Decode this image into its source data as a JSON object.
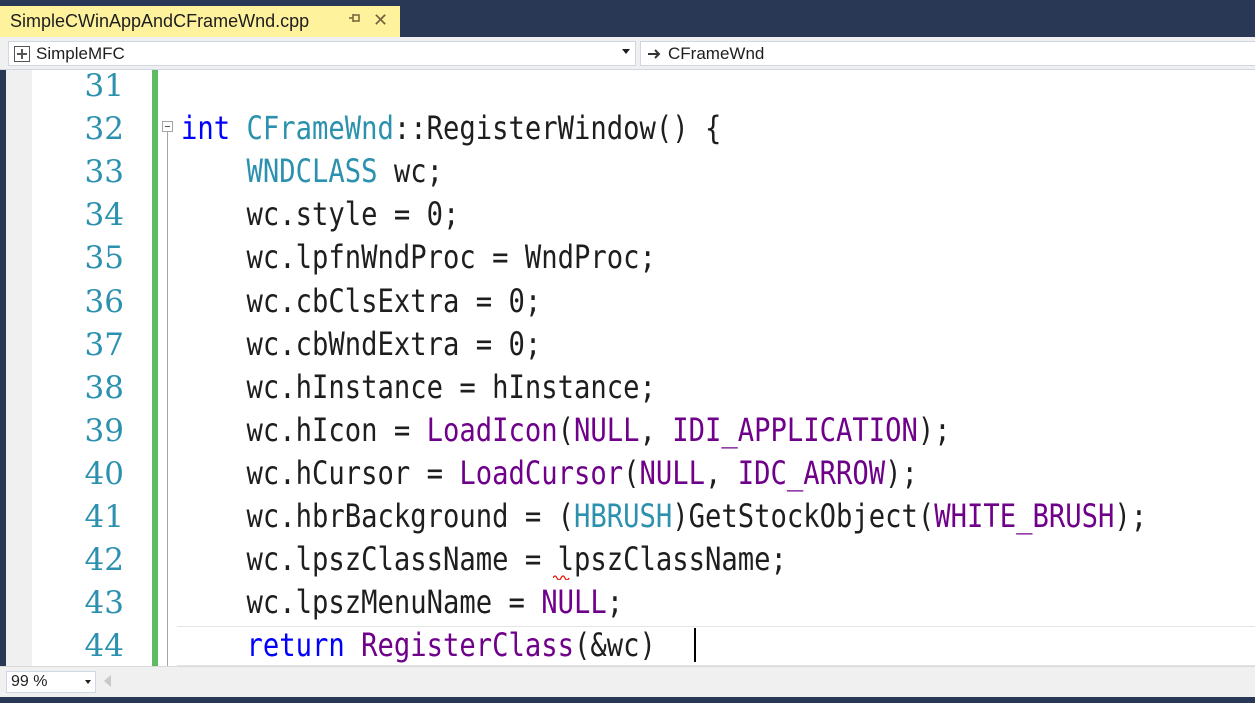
{
  "tab": {
    "title": "SimpleCWinAppAndCFrameWnd.cpp",
    "pin_icon": "pin-icon",
    "close_icon": "close-icon"
  },
  "nav": {
    "project": "SimpleMFC",
    "scope": "CFrameWnd"
  },
  "colors": {
    "keyword": "#0000ff",
    "type": "#2b91af",
    "macro": "#6f008a",
    "text": "#1e1e1e",
    "line_number": "#2b91af",
    "change_bar": "#5dbb63",
    "tab_active": "#fff29d",
    "frame": "#293955"
  },
  "editor": {
    "lines": [
      {
        "num": "31",
        "tokens": []
      },
      {
        "num": "32",
        "tokens": [
          {
            "t": "int",
            "c": "kw"
          },
          {
            "t": " "
          },
          {
            "t": "CFrameWnd",
            "c": "ty"
          },
          {
            "t": "::RegisterWindow() {"
          }
        ]
      },
      {
        "num": "33",
        "tokens": [
          {
            "t": "    "
          },
          {
            "t": "WNDCLASS",
            "c": "ty"
          },
          {
            "t": " wc;"
          }
        ]
      },
      {
        "num": "34",
        "tokens": [
          {
            "t": "    wc.style = 0;"
          }
        ]
      },
      {
        "num": "35",
        "tokens": [
          {
            "t": "    wc.lpfnWndProc = WndProc;"
          }
        ]
      },
      {
        "num": "36",
        "tokens": [
          {
            "t": "    wc.cbClsExtra = 0;"
          }
        ]
      },
      {
        "num": "37",
        "tokens": [
          {
            "t": "    wc.cbWndExtra = 0;"
          }
        ]
      },
      {
        "num": "38",
        "tokens": [
          {
            "t": "    wc.hInstance = hInstance;"
          }
        ]
      },
      {
        "num": "39",
        "tokens": [
          {
            "t": "    wc.hIcon = "
          },
          {
            "t": "LoadIcon",
            "c": "fn"
          },
          {
            "t": "("
          },
          {
            "t": "NULL",
            "c": "fn"
          },
          {
            "t": ", "
          },
          {
            "t": "IDI_APPLICATION",
            "c": "fn"
          },
          {
            "t": ");"
          }
        ]
      },
      {
        "num": "40",
        "tokens": [
          {
            "t": "    wc.hCursor = "
          },
          {
            "t": "LoadCursor",
            "c": "fn"
          },
          {
            "t": "("
          },
          {
            "t": "NULL",
            "c": "fn"
          },
          {
            "t": ", "
          },
          {
            "t": "IDC_ARROW",
            "c": "fn"
          },
          {
            "t": ");"
          }
        ]
      },
      {
        "num": "41",
        "tokens": [
          {
            "t": "    wc.hbrBackground = ("
          },
          {
            "t": "HBRUSH",
            "c": "ty"
          },
          {
            "t": ")GetStockObject("
          },
          {
            "t": "WHITE_BRUSH",
            "c": "fn"
          },
          {
            "t": ");"
          }
        ]
      },
      {
        "num": "42",
        "tokens": [
          {
            "t": "    wc.lpszClassName = lpszClassName;"
          }
        ]
      },
      {
        "num": "43",
        "tokens": [
          {
            "t": "    wc.lpszMenuName = "
          },
          {
            "t": "NULL",
            "c": "fn"
          },
          {
            "t": ";"
          }
        ]
      },
      {
        "num": "44",
        "tokens": [
          {
            "t": "    "
          },
          {
            "t": "return",
            "c": "kw"
          },
          {
            "t": " "
          },
          {
            "t": "RegisterClass",
            "c": "fn"
          },
          {
            "t": "(&wc)"
          }
        ]
      }
    ]
  },
  "status": {
    "zoom": "99 %"
  }
}
